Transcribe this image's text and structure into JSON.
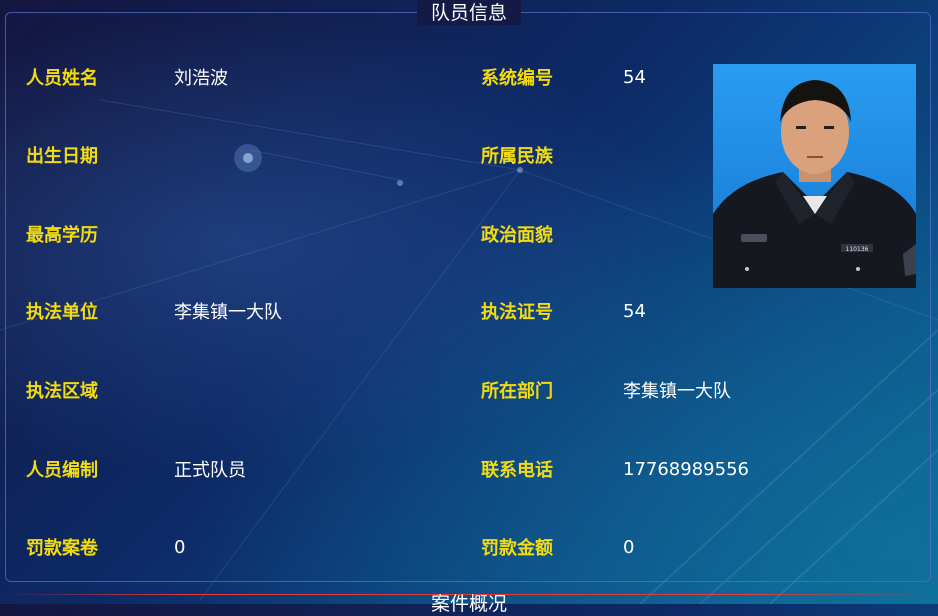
{
  "panel": {
    "title": "队员信息"
  },
  "left": [
    {
      "label": "人员姓名",
      "value": "刘浩波"
    },
    {
      "label": "出生日期",
      "value": ""
    },
    {
      "label": "最高学历",
      "value": ""
    },
    {
      "label": "执法单位",
      "value": "李集镇一大队"
    },
    {
      "label": "执法区域",
      "value": ""
    },
    {
      "label": "人员编制",
      "value": "正式队员"
    },
    {
      "label": "罚款案卷",
      "value": "0"
    }
  ],
  "right": [
    {
      "label": "系统编号",
      "value": "54"
    },
    {
      "label": "所属民族",
      "value": ""
    },
    {
      "label": "政治面貌",
      "value": ""
    },
    {
      "label": "执法证号",
      "value": "54"
    },
    {
      "label": "所在部门",
      "value": "李集镇一大队"
    },
    {
      "label": "联系电话",
      "value": "17768989556"
    },
    {
      "label": "罚款金额",
      "value": "0"
    }
  ],
  "photo": {
    "badge_text": "110136"
  },
  "next_section": {
    "title": "案件概况"
  },
  "colors": {
    "label": "#f2dc10",
    "value": "#ffffff",
    "border": "#5a6ec8"
  }
}
